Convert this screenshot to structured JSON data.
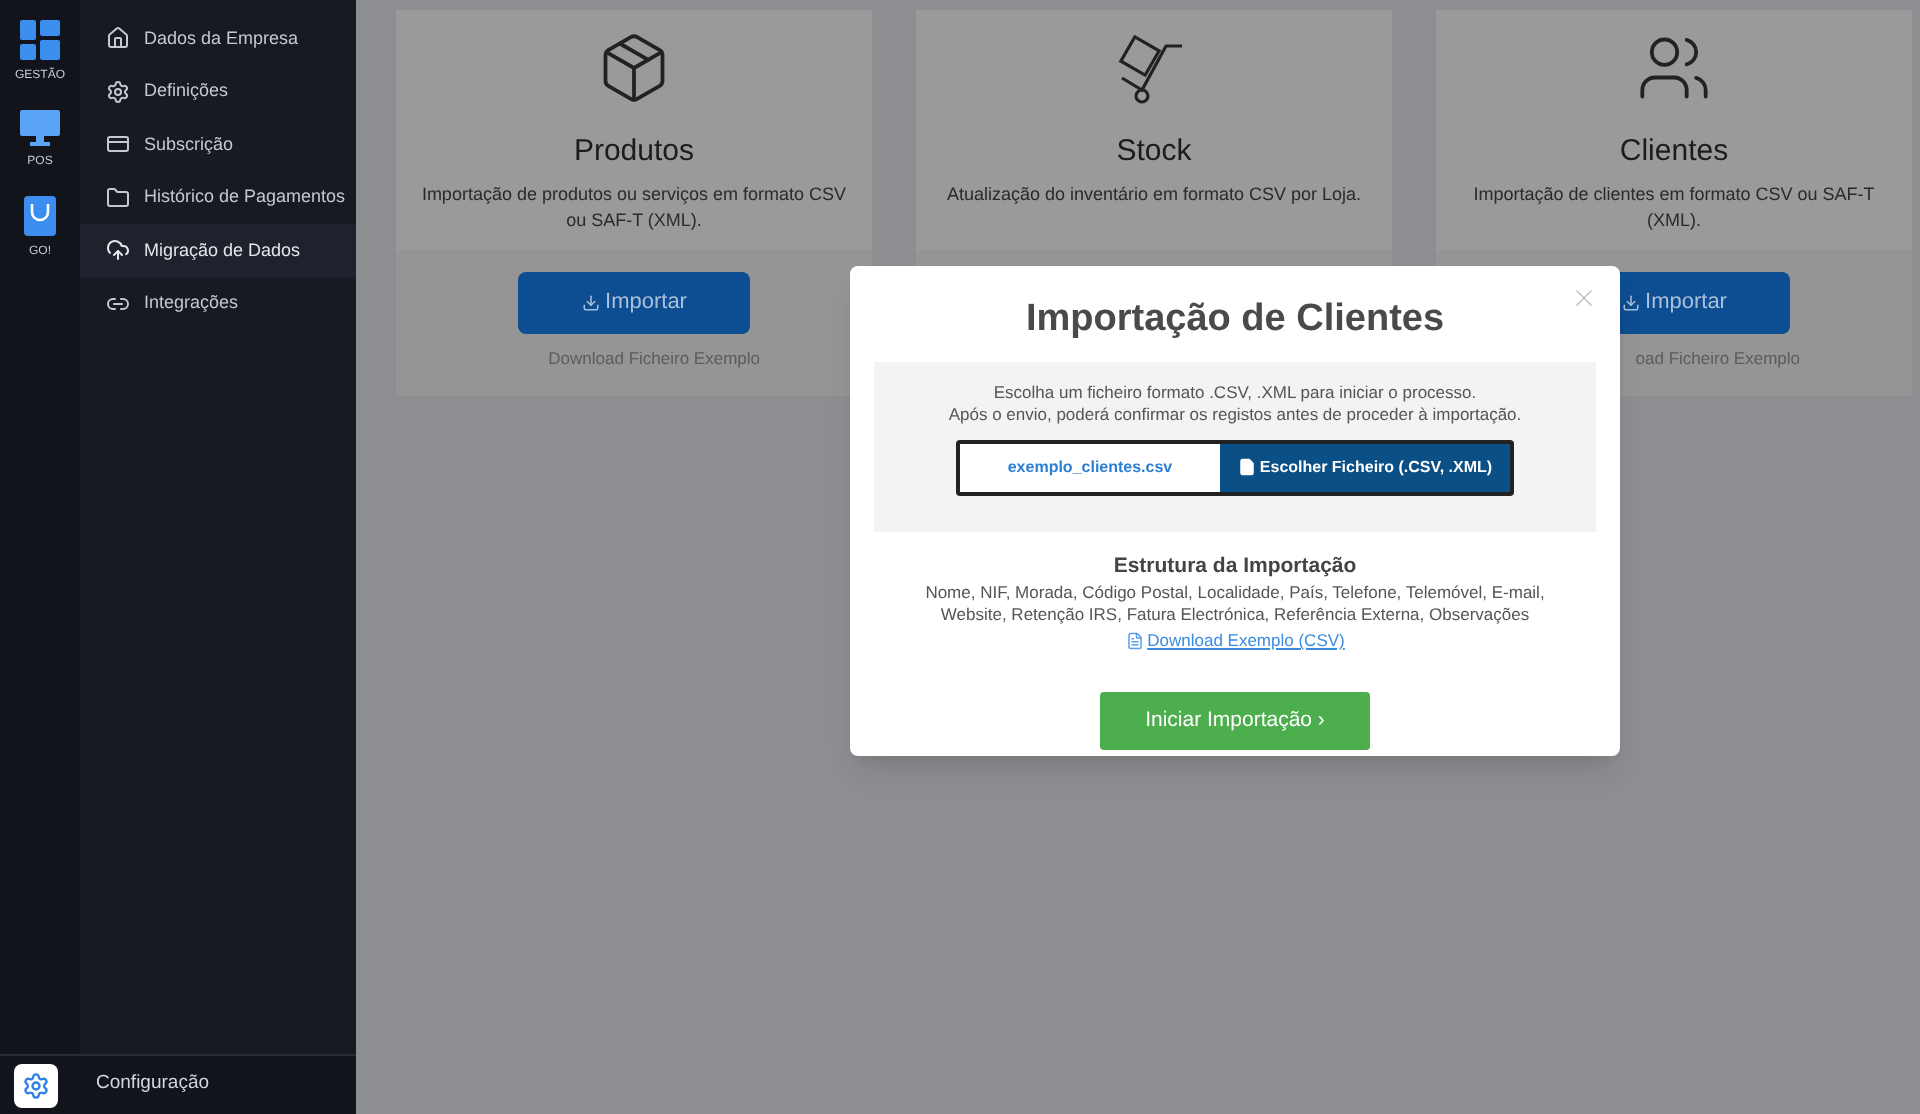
{
  "rail": {
    "items": [
      {
        "kind": "tiles",
        "label": "GESTÃO"
      },
      {
        "kind": "monitor",
        "label": "POS"
      },
      {
        "kind": "bag",
        "label": "GO!"
      }
    ]
  },
  "sidebar": {
    "items": [
      {
        "kind": "home",
        "label": "Dados da Empresa",
        "selected": false
      },
      {
        "kind": "gear",
        "label": "Definições",
        "selected": false
      },
      {
        "kind": "card",
        "label": "Subscrição",
        "selected": false
      },
      {
        "kind": "folder",
        "label": "Histórico de Pagamentos",
        "selected": false
      },
      {
        "kind": "upload",
        "label": "Migração de Dados",
        "selected": true
      },
      {
        "kind": "link",
        "label": "Integrações",
        "selected": false
      }
    ]
  },
  "footer": {
    "label": "Configuração"
  },
  "cards": [
    {
      "kind": "box",
      "title": "Produtos",
      "description": "Importação de produtos ou serviços em formato CSV ou SAF-T (XML).",
      "button": "Importar",
      "link": "Download Ficheiro Exemplo"
    },
    {
      "kind": "trolley",
      "title": "Stock",
      "description": "Atualização do inventário em formato CSV por Loja."
    },
    {
      "kind": "people",
      "title": "Clientes",
      "description": "Importação de clientes em formato CSV ou SAF-T (XML).",
      "button": "Importar",
      "link": "oad Ficheiro Exemplo"
    }
  ],
  "modal": {
    "title": "Importação de Clientes",
    "instructions": [
      "Escolha um ficheiro formato .CSV, .XML para iniciar o processo.",
      "Após o envio, poderá confirmar os registos antes de proceder à importação."
    ],
    "file_name": "exemplo_clientes.csv",
    "choose_button": "Escolher Ficheiro (.CSV, .XML)",
    "structure_title": "Estrutura da Importação",
    "structure_fields": "Nome, NIF, Morada, Código Postal, Localidade, País, Telefone, Telemóvel, E-mail, Website, Retenção IRS, Fatura Electrónica, Referência Externa, Observações",
    "download_link": "Download Exemplo (CSV)",
    "submit": "Iniciar Importação ›"
  }
}
